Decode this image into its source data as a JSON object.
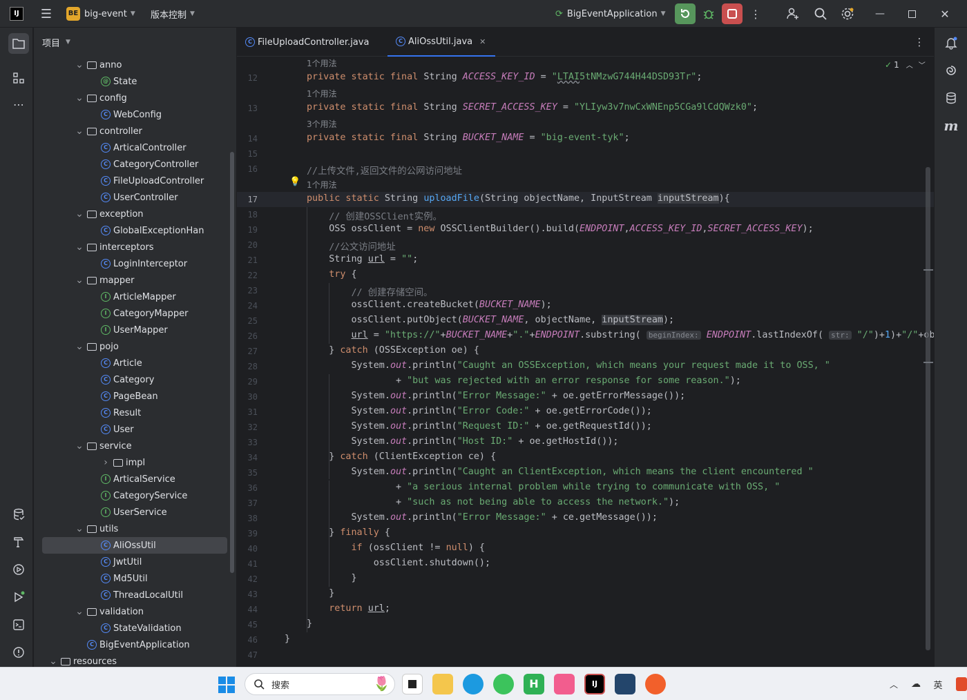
{
  "titlebar": {
    "project_badge": "BE",
    "project_name": "big-event",
    "vcs": "版本控制",
    "run_config": "BigEventApplication"
  },
  "project_panel": {
    "title": "项目",
    "tree": [
      {
        "label": "anno",
        "type": "folder",
        "depth": 1,
        "expanded": true
      },
      {
        "label": "State",
        "type": "annotation",
        "depth": 2
      },
      {
        "label": "config",
        "type": "folder",
        "depth": 1,
        "expanded": true
      },
      {
        "label": "WebConfig",
        "type": "class",
        "depth": 2
      },
      {
        "label": "controller",
        "type": "folder",
        "depth": 1,
        "expanded": true
      },
      {
        "label": "ArticalController",
        "type": "class",
        "depth": 2
      },
      {
        "label": "CategoryController",
        "type": "class",
        "depth": 2
      },
      {
        "label": "FileUploadController",
        "type": "class",
        "depth": 2
      },
      {
        "label": "UserController",
        "type": "class",
        "depth": 2
      },
      {
        "label": "exception",
        "type": "folder",
        "depth": 1,
        "expanded": true
      },
      {
        "label": "GlobalExceptionHan",
        "type": "class",
        "depth": 2
      },
      {
        "label": "interceptors",
        "type": "folder",
        "depth": 1,
        "expanded": true
      },
      {
        "label": "LoginInterceptor",
        "type": "class",
        "depth": 2
      },
      {
        "label": "mapper",
        "type": "folder",
        "depth": 1,
        "expanded": true
      },
      {
        "label": "ArticleMapper",
        "type": "interface",
        "depth": 2
      },
      {
        "label": "CategoryMapper",
        "type": "interface",
        "depth": 2
      },
      {
        "label": "UserMapper",
        "type": "interface",
        "depth": 2
      },
      {
        "label": "pojo",
        "type": "folder",
        "depth": 1,
        "expanded": true
      },
      {
        "label": "Article",
        "type": "class",
        "depth": 2
      },
      {
        "label": "Category",
        "type": "class",
        "depth": 2
      },
      {
        "label": "PageBean",
        "type": "class",
        "depth": 2
      },
      {
        "label": "Result",
        "type": "class",
        "depth": 2
      },
      {
        "label": "User",
        "type": "class",
        "depth": 2
      },
      {
        "label": "service",
        "type": "folder",
        "depth": 1,
        "expanded": true
      },
      {
        "label": "impl",
        "type": "folder",
        "depth": 2,
        "expanded": false
      },
      {
        "label": "ArticalService",
        "type": "interface",
        "depth": 2
      },
      {
        "label": "CategoryService",
        "type": "interface",
        "depth": 2
      },
      {
        "label": "UserService",
        "type": "interface",
        "depth": 2
      },
      {
        "label": "utils",
        "type": "folder",
        "depth": 1,
        "expanded": true
      },
      {
        "label": "AliOssUtil",
        "type": "class",
        "depth": 2,
        "selected": true
      },
      {
        "label": "JwtUtil",
        "type": "class",
        "depth": 2
      },
      {
        "label": "Md5Util",
        "type": "class",
        "depth": 2
      },
      {
        "label": "ThreadLocalUtil",
        "type": "class",
        "depth": 2
      },
      {
        "label": "validation",
        "type": "folder",
        "depth": 1,
        "expanded": true
      },
      {
        "label": "StateValidation",
        "type": "class",
        "depth": 2
      },
      {
        "label": "BigEventApplication",
        "type": "app",
        "depth": 1
      },
      {
        "label": "resources",
        "type": "folder",
        "depth": 0,
        "expanded": true
      }
    ]
  },
  "tabs": [
    {
      "label": "FileUploadController.java",
      "active": false
    },
    {
      "label": "AliOssUtil.java",
      "active": true
    }
  ],
  "editor": {
    "inspection_count": "1",
    "hints": {
      "h1": "1个用法",
      "h2": "1个用法",
      "h3": "3个用法",
      "h4": "1个用法"
    },
    "line_numbers": [
      "12",
      "13",
      "14",
      "15",
      "16",
      "17",
      "18",
      "19",
      "20",
      "21",
      "22",
      "23",
      "24",
      "25",
      "26",
      "27",
      "28",
      "29",
      "30",
      "31",
      "32",
      "33",
      "34",
      "35",
      "36",
      "37",
      "38",
      "39",
      "40",
      "41",
      "42",
      "43",
      "44",
      "45",
      "46",
      "47"
    ],
    "inlay_beginIndex": "beginIndex:",
    "inlay_str": "str:",
    "current_line": "17"
  },
  "taskbar": {
    "search_placeholder": "搜索"
  }
}
